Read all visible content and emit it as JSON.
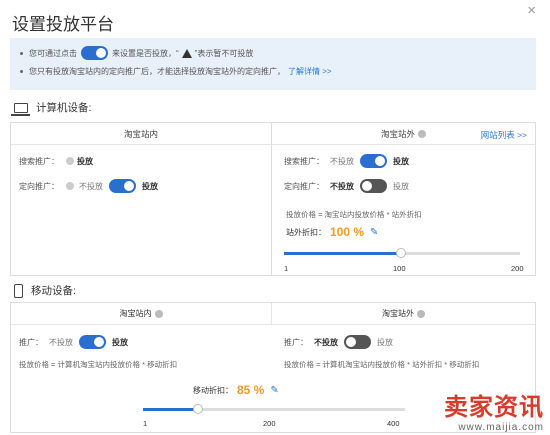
{
  "page": {
    "title": "设置投放平台",
    "close_icon": "close-icon"
  },
  "notice": {
    "line1_pre": "您可通过点击",
    "line1_mid": "来设置是否投放，“",
    "line1_post": "”表示暂不可投放",
    "line2_text": "您只有投放淘宝站内的定向推广后，才能选择投放淘宝站外的定向推广，",
    "line2_link": "了解详情 >>"
  },
  "computer": {
    "heading": "计算机设备:",
    "inside": {
      "title": "淘宝站内",
      "search_label": "搜索推广：",
      "search_status": "投放",
      "targeting_label": "定向推广：",
      "off_label": "不投放",
      "on_label": "投放"
    },
    "outside": {
      "title": "淘宝站外",
      "link": "网站列表 >>",
      "search_label": "搜索推广：",
      "search_off": "不投放",
      "search_on": "投放",
      "targeting_label": "定向推广：",
      "targeting_off": "不投放",
      "targeting_on": "投放",
      "formula": "投放价格 = 淘宝站内投放价格 * 站外折扣",
      "discount_label": "站外折扣：",
      "discount_value": "100 %",
      "slider": {
        "min_label": "1",
        "mid_label": "100",
        "max_label": "200",
        "value": 100,
        "min": 1,
        "max": 200
      }
    }
  },
  "mobile": {
    "heading": "移动设备:",
    "inside": {
      "title": "淘宝站内",
      "promo_label": "推广：",
      "off_label": "不投放",
      "on_label": "投放",
      "formula": "投放价格 = 计算机淘宝站内投放价格 * 移动折扣"
    },
    "outside": {
      "title": "淘宝站外",
      "promo_label": "推广：",
      "off_label": "不投放",
      "on_label": "投放",
      "formula": "投放价格 = 计算机淘宝站内投放价格 * 站外折扣 * 移动折扣"
    },
    "discount_label": "移动折扣：",
    "discount_value": "85 %",
    "slider": {
      "min_label": "1",
      "mid_label": "200",
      "max_label": "400",
      "value": 85,
      "min": 1,
      "max": 400
    }
  },
  "watermark": {
    "main": "卖家资讯",
    "sub": "www.maijia.com"
  }
}
